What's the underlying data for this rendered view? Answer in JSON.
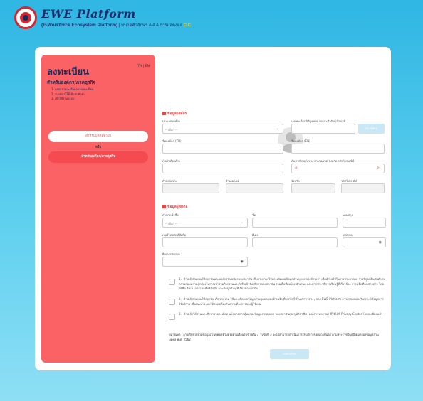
{
  "header": {
    "brand": "EWE Platform",
    "subtitle": "(E-Workforce Ecosystem Platform)",
    "font_size_label": "ขนาดตัวอักษร",
    "font_size_options": "A A A",
    "contrast_label": "การแสดงผล",
    "contrast_options": "C C"
  },
  "left_panel": {
    "title": "ลงทะเบียน",
    "lang": "TH | EN",
    "subtitle": "สำหรับองค์กร/ภาคธุรกิจ",
    "steps": [
      "1. กรอกรายละเอียดการลงทะเบียน",
      "2. รับรหัส OTP ยืนยันตัวตน",
      "3. เข้าใช้งานระบบ"
    ],
    "person_button": "สำหรับบุคคลทั่วไป",
    "or_label": "หรือ",
    "org_button": "สำหรับองค์กร/ภาคธุรกิจ"
  },
  "org_section": {
    "title": "ข้อมูลองค์กร",
    "org_type_label": "ประเภทองค์กร",
    "org_type_value": "-- เลือก --",
    "tax_id_label": "เลขทะเบียนนิติบุคคล/เลขประจำตัวผู้เสียภาษี",
    "verify_button": "ตรวจสอบ",
    "name_th_label": "ชื่อองค์กร (TH)",
    "name_en_label": "ชื่อองค์กร (EN)",
    "website_label": "เว็บไซต์องค์กร",
    "address_search_label": "ค้นหาตำบล/แขวง อำเภอ/เขต จังหวัด รหัสไปรษณีย์",
    "subdistrict_label": "ตำบล/แขวง",
    "district_label": "อำเภอ/เขต",
    "province_label": "จังหวัด",
    "postcode_label": "รหัสไปรษณีย์"
  },
  "contact_section": {
    "title": "ข้อมูลผู้ติดต่อ",
    "prefix_label": "คำนำหน้าชื่อ",
    "prefix_value": "-- เลือก --",
    "firstname_label": "ชื่อ",
    "lastname_label": "นามสกุล",
    "phone_label": "เบอร์โทรศัพท์มือถือ",
    "email_label": "อีเมล",
    "password_label": "รหัสผ่าน",
    "confirm_password_label": "ยืนยันรหัสผ่าน"
  },
  "consents": [
    "1.) ข้าพเจ้ายินยอมให้สถาบันและองค์กรพันธมิตรของสถาบัน เก็บรวบรวม ใช้และเปิดเผยข้อมูลส่วนบุคคลของข้าพเจ้า เพื่อนำไปใช้ในการประมวลผล การพิสูจน์ยืนยันตัวตน ตรวจสอบความถูกต้องในการเข้าร่วมกิจกรรมและ/หรือเข้ารับบริการของสถาบัน รวมทั้งเชื่อมโยง นำเสนอ และฝากประวัติการเรียนรู้ที่เกี่ยวข้อง การแจ้งเตือนข่าวสาร โดยใช้ชื่อ อีเมล เบอร์โทรศัพท์มือถือ และข้อมูลอื่นๆ ที่เกี่ยวข้องเท่านั้น",
    "2.) ข้าพเจ้ายินยอมให้สถาบัน เก็บรวบรวม ใช้และเปิดเผยข้อมูลส่วนบุคคลของข้าพเจ้าเพื่อนำไปใช้ในบริการต่างๆ ของ EWE Platform การสรุปผลและวิเคราะห์ข้อมูลการใช้บริการ เพื่อพัฒนาระบบให้สอดคล้องกับความต้องการของผู้ใช้งาน",
    "3.) ข้าพเจ้าได้อ่านและศึกษารายละเอียด นโยบายการคุ้มครองข้อมูลส่วนบุคคล ของสถาบันคุณวุฒิวิชาชีพ (องค์การมหาชน) ที่ใช้ได้ที่ Privacy Center โดยละเอียดแล้ว"
  ],
  "consent_link_text": "นโยบายการคุ้มครองข้อมูลส่วนบุคคล",
  "note": "หมายเหตุ : การเก็บรวบรวมข้อมูลส่วนบุคคลที่ไม่ตรงตามเงื่อนไขข้างต้น ✓ ในข้อที่ 3 จะไม่สามารถดำเนินการใช้บริการของสถาบันได้ ตามพระราชบัญญัติคุ้มครองข้อมูลส่วนบุคคล พ.ศ. 2562",
  "submit_button": "ลงทะเบียน",
  "colors": {
    "accent": "#fb6266",
    "brand": "#1b2c6b",
    "background": "#2fb6e3"
  },
  "icons": [
    "logo-icon",
    "camera-icon",
    "chevron-down-icon",
    "pin-icon",
    "refresh-icon",
    "eye-icon",
    "building-icon",
    "contact-icon"
  ]
}
